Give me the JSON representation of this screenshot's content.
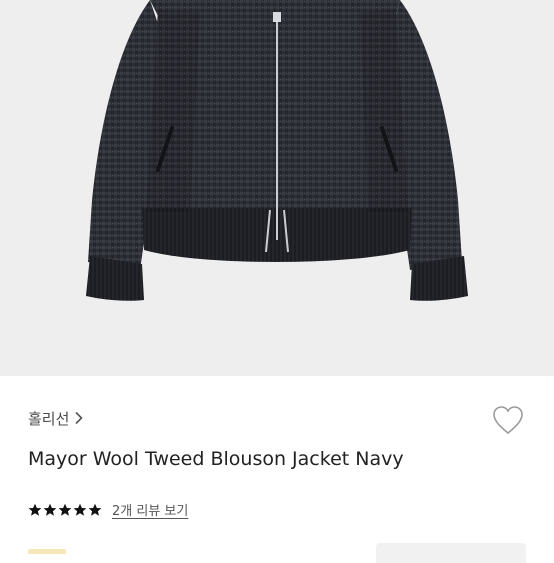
{
  "product": {
    "brand": "홀리선",
    "title": "Mayor Wool Tweed Blouson Jacket Navy",
    "rating": 5,
    "review_link": "2개 리뷰 보기"
  },
  "icons": {
    "brand_chevron": "chevron-right-icon",
    "wishlist": "heart-outline-icon",
    "rating_star": "star-filled-icon"
  },
  "colors": {
    "photo_bg": "#eeeeee",
    "jacket": "#2b2d33",
    "star": "#111111",
    "heart_stroke": "#9a9a9a"
  }
}
